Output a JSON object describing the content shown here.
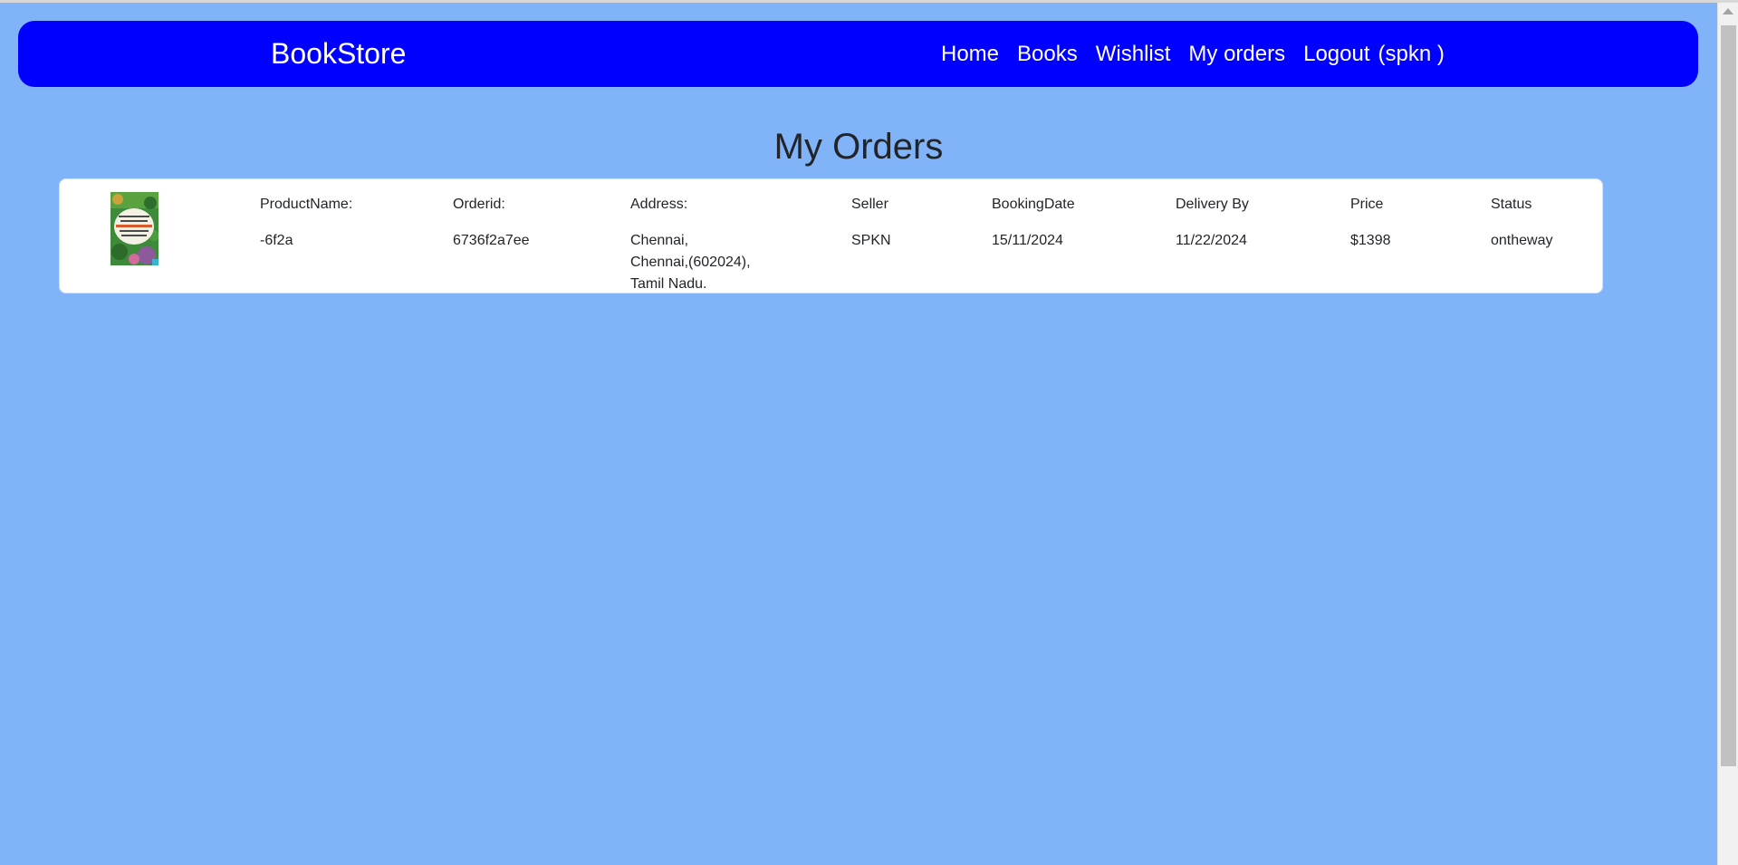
{
  "navbar": {
    "brand": "BookStore",
    "links": {
      "home": "Home",
      "books": "Books",
      "wishlist": "Wishlist",
      "my_orders": "My orders",
      "logout": "Logout",
      "user": "(spkn )"
    }
  },
  "page": {
    "title": "My Orders"
  },
  "orders": [
    {
      "headers": {
        "product_name": "ProductName:",
        "orderid": "Orderid:",
        "address": "Address:",
        "seller": "Seller",
        "booking_date": "BookingDate",
        "delivery_by": "Delivery By",
        "price": "Price",
        "status": "Status"
      },
      "values": {
        "product_name": "-6f2a",
        "orderid": "6736f2a7ee",
        "address_line1": "Chennai,",
        "address_line2": "Chennai,(602024),",
        "address_line3": "Tamil Nadu.",
        "seller": "SPKN",
        "booking_date": "15/11/2024",
        "delivery_by": "11/22/2024",
        "price": "$1398",
        "status": "ontheway"
      }
    }
  ],
  "colors": {
    "background": "#80b3f7",
    "navbar": "#0000ff",
    "card": "#ffffff"
  }
}
